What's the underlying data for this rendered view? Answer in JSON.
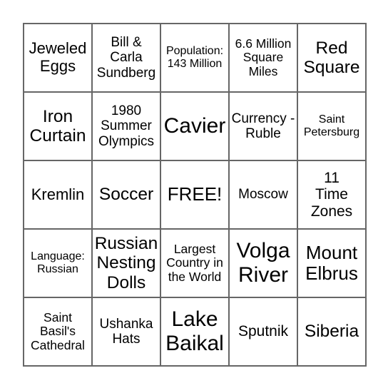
{
  "board": {
    "free_space_label": "FREE!",
    "cells": [
      [
        "Jeweled Eggs",
        "Bill & Carla Sundberg",
        "Population: 143 Million",
        "6.6 Million Square Miles",
        "Red Square"
      ],
      [
        "Iron Curtain",
        "1980 Summer Olympics",
        "Cavier",
        "Currency - Ruble",
        "Saint Petersburg"
      ],
      [
        "Kremlin",
        "Soccer",
        "FREE!",
        "Moscow",
        "11 Time Zones"
      ],
      [
        "Language: Russian",
        "Russian Nesting Dolls",
        "Largest Country in the World",
        "Volga River",
        "Mount Elbrus"
      ],
      [
        "Saint Basil's Cathedral",
        "Ushanka Hats",
        "Lake Baikal",
        "Sputnik",
        "Siberia"
      ]
    ]
  }
}
